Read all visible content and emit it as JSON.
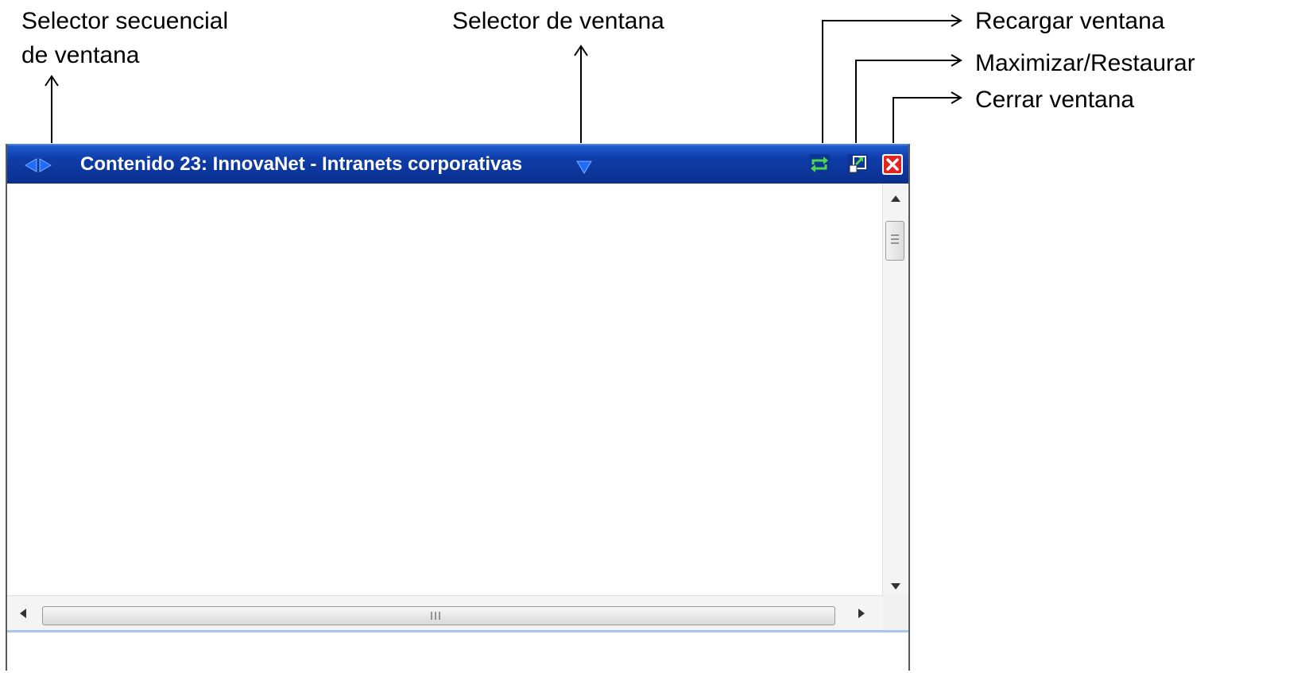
{
  "callouts": {
    "seq_selector_line1": "Selector secuencial",
    "seq_selector_line2": "de ventana",
    "window_selector": "Selector de ventana",
    "reload": "Recargar ventana",
    "maximize": "Maximizar/Restaurar",
    "close": "Cerrar ventana"
  },
  "window": {
    "title": "Contenido 23: InnovaNet - Intranets corporativas",
    "titlebar_color": "#0f3da8",
    "icons": {
      "seq_nav": "left-right-arrows-icon",
      "selector": "triangle-down-icon",
      "reload": "reload-icon",
      "maximize": "maximize-restore-icon",
      "close": "close-icon"
    }
  }
}
